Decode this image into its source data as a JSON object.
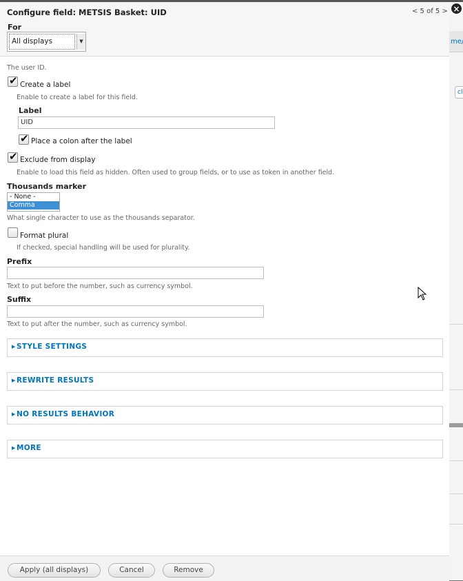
{
  "dialog": {
    "title": "Configure field: METSIS Basket: UID",
    "pager": "< 5 of 5 >",
    "close_icon": "×",
    "for_label": "For",
    "for_value": "All displays"
  },
  "form": {
    "intro": "The user ID.",
    "create_label": {
      "label": "Create a label",
      "checked": true,
      "description": "Enable to create a label for this field."
    },
    "label_field": {
      "label": "Label",
      "value": "UID"
    },
    "place_colon": {
      "label": "Place a colon after the label",
      "checked": true
    },
    "exclude": {
      "label": "Exclude from display",
      "checked": true,
      "description": "Enable to load this field as hidden. Often used to group fields, or to use as token in another field."
    },
    "thousands": {
      "label": "Thousands marker",
      "options": [
        "- None -",
        "Comma"
      ],
      "selected": "Comma",
      "description": "What single character to use as the thousands separator."
    },
    "format_plural": {
      "label": "Format plural",
      "checked": false,
      "description": "If checked, special handling will be used for plurality."
    },
    "prefix": {
      "label": "Prefix",
      "value": "",
      "description": "Text to put before the number, such as currency symbol."
    },
    "suffix": {
      "label": "Suffix",
      "value": "",
      "description": "Text to put after the number, such as currency symbol."
    },
    "sections": [
      "STYLE SETTINGS",
      "REWRITE RESULTS",
      "NO RESULTS BEHAVIOR",
      "MORE"
    ]
  },
  "buttons": {
    "apply": "Apply (all displays)",
    "cancel": "Cancel",
    "remove": "Remove"
  },
  "background": {
    "text": "me/"
  }
}
